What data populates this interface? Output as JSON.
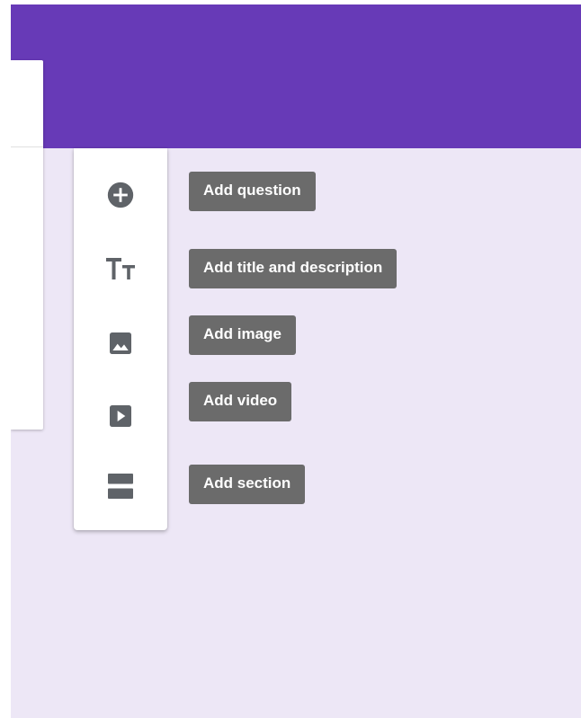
{
  "theme": {
    "header_color": "#673ab7",
    "background_color": "#ede7f6",
    "icon_color": "#5f6368",
    "tooltip_color": "#6b6b6b"
  },
  "toolbar": {
    "items": [
      {
        "icon": "add-circle-icon",
        "tooltip": "Add question"
      },
      {
        "icon": "title-icon",
        "tooltip": "Add title and description"
      },
      {
        "icon": "image-icon",
        "tooltip": "Add image"
      },
      {
        "icon": "video-icon",
        "tooltip": "Add video"
      },
      {
        "icon": "section-icon",
        "tooltip": "Add section"
      }
    ]
  }
}
